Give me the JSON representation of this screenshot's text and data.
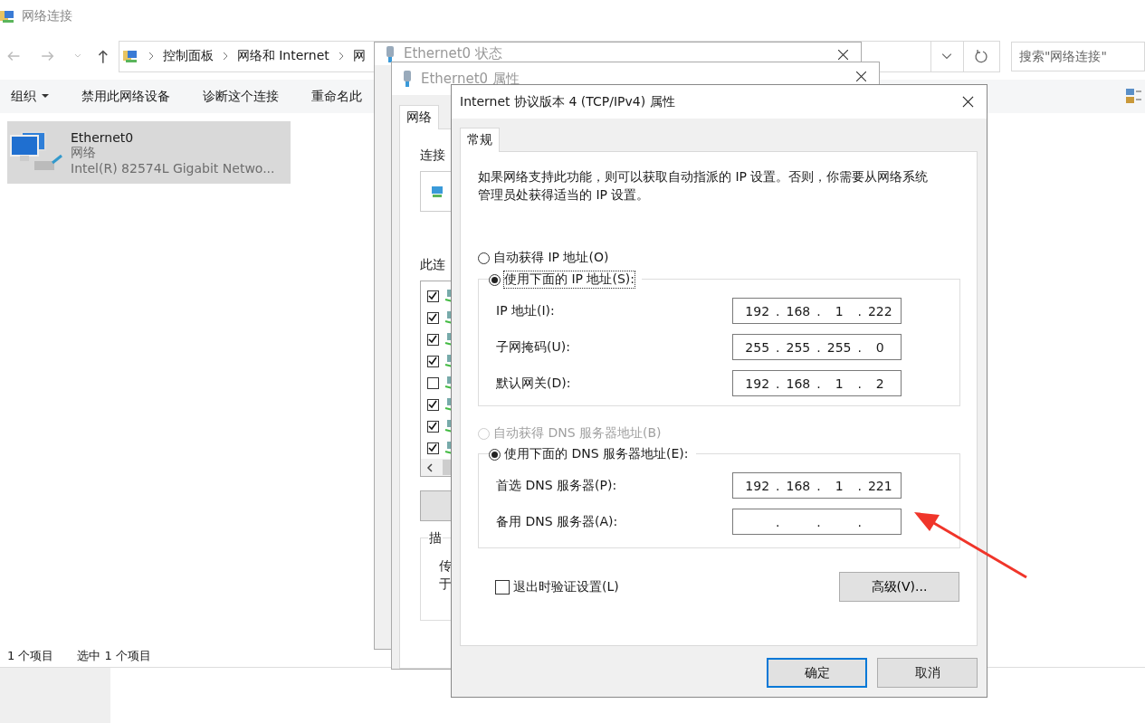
{
  "explorer": {
    "title": "网络连接",
    "breadcrumb": [
      "控制面板",
      "网络和 Internet",
      "网"
    ],
    "search": {
      "placeholder": "搜索\"网络连接\""
    },
    "toolbar": [
      {
        "label": "组织",
        "menu": true
      },
      {
        "label": "禁用此网络设备",
        "menu": false
      },
      {
        "label": "诊断这个连接",
        "menu": false
      },
      {
        "label": "重命名此",
        "menu": false
      }
    ],
    "items": [
      {
        "name": "Ethernet0",
        "type": "网络",
        "adapter": "Intel(R) 82574L Gigabit Netwo...",
        "selected": true
      }
    ],
    "status_bar": [
      "1 个项目",
      "选中 1 个项目"
    ]
  },
  "status_window": {
    "title": "Ethernet0 状态"
  },
  "properties_window": {
    "title": "Ethernet0 属性",
    "tabs": [
      {
        "label": "网络",
        "selected": true
      }
    ],
    "connect_label": "连接",
    "components_label": "此连",
    "components": [
      {
        "checked": true
      },
      {
        "checked": true
      },
      {
        "checked": true
      },
      {
        "checked": true
      },
      {
        "checked": false
      },
      {
        "checked": true
      },
      {
        "checked": true
      },
      {
        "checked": true
      }
    ],
    "description": {
      "legend": "描",
      "lines": [
        "传",
        "于"
      ]
    }
  },
  "ipv4_dialog": {
    "title": "Internet 协议版本 4 (TCP/IPv4) 属性",
    "tabs": [
      {
        "label": "常规",
        "selected": true
      }
    ],
    "intro": "如果网络支持此功能，则可以获取自动指派的 IP 设置。否则，你需要从网络系统管理员处获得适当的 IP 设置。",
    "groups": [
      {
        "auto": {
          "label": "自动获得 IP 地址(O)",
          "selected": false,
          "disabled": false
        },
        "manual": {
          "label": "使用下面的 IP 地址(S):",
          "selected": true,
          "focused": true
        },
        "fields": [
          {
            "label": "IP 地址(I):",
            "octets": [
              "192",
              "168",
              "1",
              "222"
            ],
            "dots": [
              ".",
              ".",
              "."
            ]
          },
          {
            "label": "子网掩码(U):",
            "octets": [
              "255",
              "255",
              "255",
              "0"
            ],
            "dots": [
              ".",
              ".",
              "."
            ]
          },
          {
            "label": "默认网关(D):",
            "octets": [
              "192",
              "168",
              "1",
              "2"
            ],
            "dots": [
              ".",
              ".",
              "."
            ]
          }
        ]
      },
      {
        "auto": {
          "label": "自动获得 DNS 服务器地址(B)",
          "selected": false,
          "disabled": true
        },
        "manual": {
          "label": "使用下面的 DNS 服务器地址(E):",
          "selected": true,
          "focused": false
        },
        "fields": [
          {
            "label": "首选 DNS 服务器(P):",
            "octets": [
              "192",
              "168",
              "1",
              "221"
            ],
            "dots": [
              ".",
              ".",
              "."
            ]
          },
          {
            "label": "备用 DNS 服务器(A):",
            "dots": [
              ".",
              ".",
              "."
            ]
          }
        ]
      }
    ],
    "validate": {
      "label": "退出时验证设置(L)",
      "checked": false
    },
    "advanced_button": "高级(V)...",
    "buttons": [
      {
        "label": "确定",
        "default": true
      },
      {
        "label": "取消",
        "default": false
      }
    ]
  },
  "annotations": [
    {
      "kind": "arrow"
    }
  ]
}
